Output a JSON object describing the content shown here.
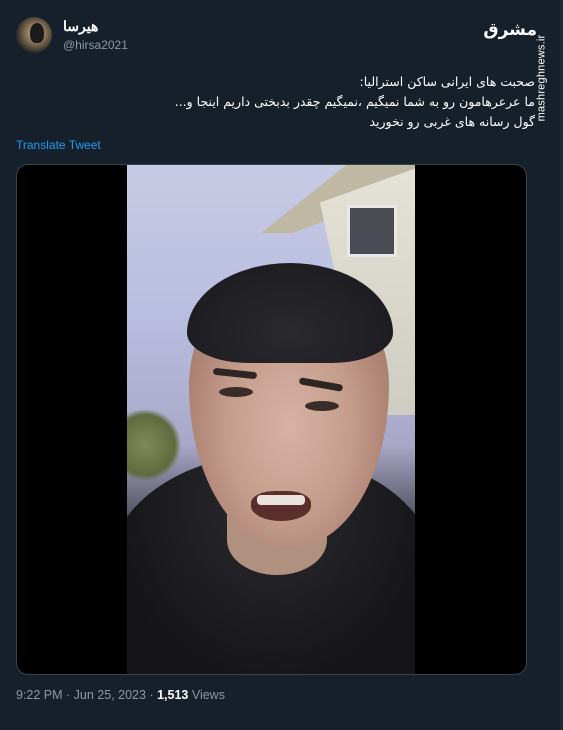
{
  "author": {
    "display_name": "هیرسا",
    "handle": "@hirsa2021"
  },
  "watermark": {
    "logo_text": "مشرق",
    "site": "mashreghnews.ir"
  },
  "tweet": {
    "lines": [
      "صحبت های ایرانی ساکن استرالیا:",
      "ما عرعرهامون رو به شما نمیگیم ،نمیگیم چقدر بدبختی داریم اینجا و...",
      "گول رسانه های غربی رو نخورید"
    ],
    "translate_label": "Translate Tweet"
  },
  "meta": {
    "time": "9:22 PM",
    "separator": " · ",
    "date": "Jun 25, 2023",
    "views_count": "1,513",
    "views_label": " Views"
  }
}
